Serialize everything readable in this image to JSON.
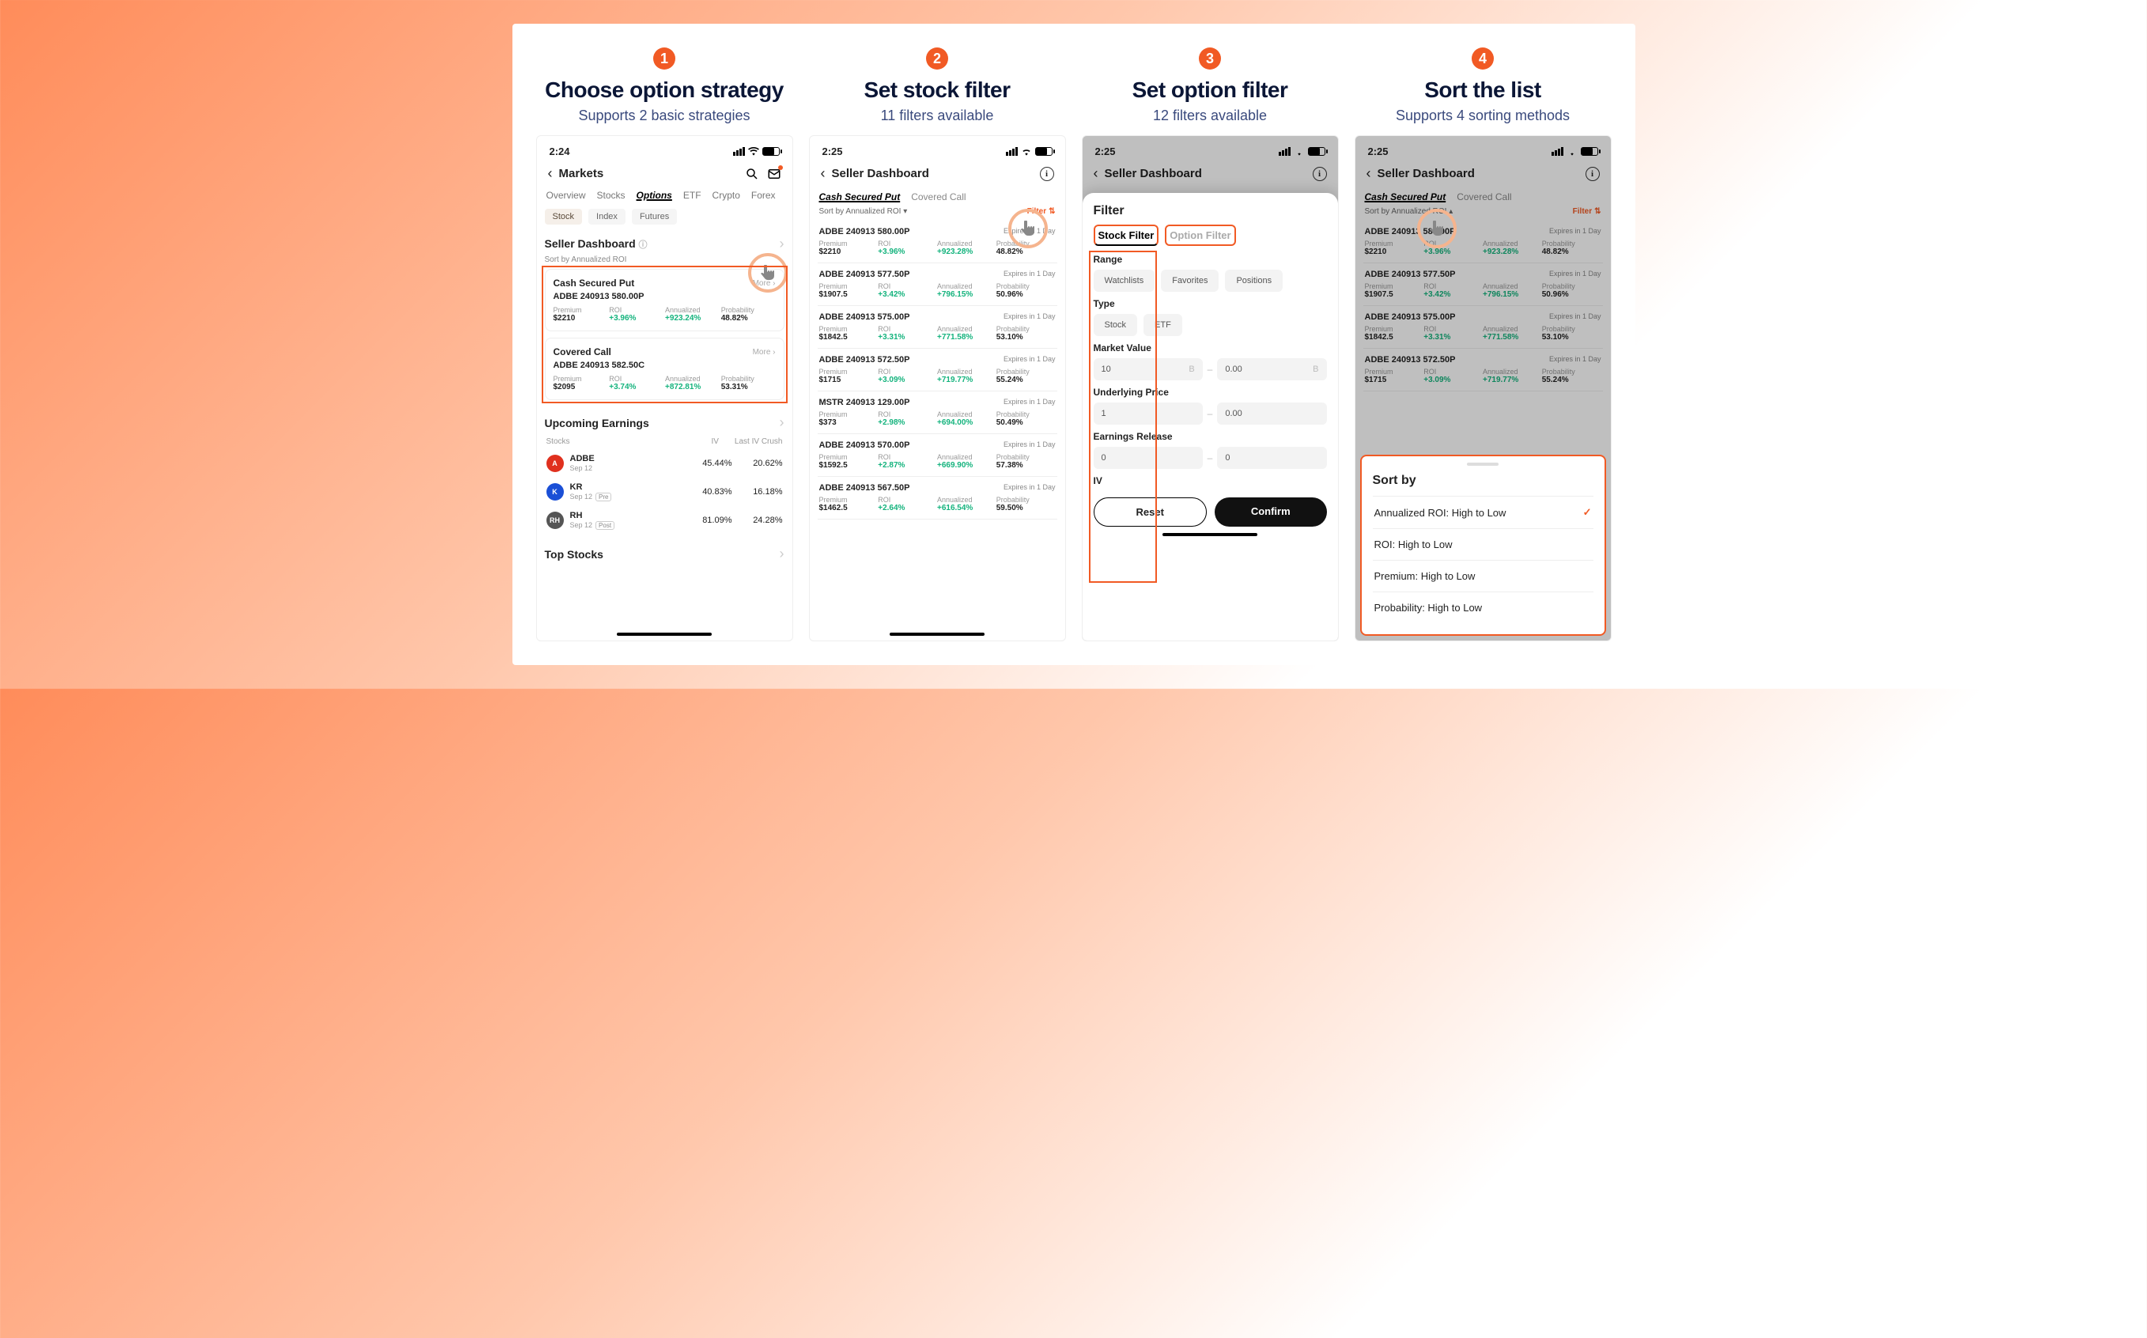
{
  "steps": [
    {
      "num": "1",
      "title": "Choose option strategy",
      "sub": "Supports 2 basic strategies"
    },
    {
      "num": "2",
      "title": "Set stock filter",
      "sub": "11 filters available"
    },
    {
      "num": "3",
      "title": "Set option filter",
      "sub": "12 filters available"
    },
    {
      "num": "4",
      "title": "Sort  the list",
      "sub": "Supports 4 sorting methods"
    }
  ],
  "p1": {
    "time": "2:24",
    "nav_title": "Markets",
    "tabs": [
      "Overview",
      "Stocks",
      "Options",
      "ETF",
      "Crypto",
      "Forex"
    ],
    "active_tab": "Options",
    "pill_row": [
      "Stock",
      "Index",
      "Futures"
    ],
    "dashboard": "Seller Dashboard",
    "sort_label": "Sort by Annualized ROI",
    "cards": [
      {
        "title": "Cash Secured Put",
        "more": "More",
        "contract": "ADBE 240913 580.00P",
        "premium_l": "Premium",
        "premium": "$2210",
        "roi_l": "ROI",
        "roi": "+3.96%",
        "ann_l": "Annualized",
        "ann": "+923.24%",
        "prob_l": "Probability",
        "prob": "48.82%"
      },
      {
        "title": "Covered Call",
        "more": "More",
        "contract": "ADBE 240913 582.50C",
        "premium_l": "Premium",
        "premium": "$2095",
        "roi_l": "ROI",
        "roi": "+3.74%",
        "ann_l": "Annualized",
        "ann": "+872.81%",
        "prob_l": "Probability",
        "prob": "53.31%"
      }
    ],
    "upcoming": "Upcoming Earnings",
    "earn_header": [
      "Stocks",
      "IV",
      "Last IV Crush"
    ],
    "earnings": [
      {
        "sym": "ADBE",
        "date": "Sep 12",
        "iv": "45.44%",
        "crush": "20.62%",
        "color": "#e0301e",
        "badge": ""
      },
      {
        "sym": "KR",
        "date": "Sep 12",
        "iv": "40.83%",
        "crush": "16.18%",
        "color": "#1a4fd6",
        "badge": "Pre"
      },
      {
        "sym": "RH",
        "date": "Sep 12",
        "iv": "81.09%",
        "crush": "24.28%",
        "color": "#555",
        "badge": "Post"
      }
    ],
    "top_stocks": "Top Stocks"
  },
  "p2": {
    "time": "2:25",
    "nav_title": "Seller Dashboard",
    "subtabs": [
      "Cash Secured Put",
      "Covered Call"
    ],
    "sort_label": "Sort by Annualized ROI ▾",
    "filter_label": "Filter",
    "col_labels": {
      "premium": "Premium",
      "roi": "ROI",
      "ann": "Annualized",
      "prob": "Probability"
    },
    "expires": "Expires in 1 Day",
    "rows": [
      {
        "c": "ADBE 240913 580.00P",
        "prem": "$2210",
        "roi": "+3.96%",
        "ann": "+923.28%",
        "prob": "48.82%"
      },
      {
        "c": "ADBE 240913 577.50P",
        "prem": "$1907.5",
        "roi": "+3.42%",
        "ann": "+796.15%",
        "prob": "50.96%"
      },
      {
        "c": "ADBE 240913 575.00P",
        "prem": "$1842.5",
        "roi": "+3.31%",
        "ann": "+771.58%",
        "prob": "53.10%"
      },
      {
        "c": "ADBE 240913 572.50P",
        "prem": "$1715",
        "roi": "+3.09%",
        "ann": "+719.77%",
        "prob": "55.24%"
      },
      {
        "c": "MSTR 240913 129.00P",
        "prem": "$373",
        "roi": "+2.98%",
        "ann": "+694.00%",
        "prob": "50.49%"
      },
      {
        "c": "ADBE 240913 570.00P",
        "prem": "$1592.5",
        "roi": "+2.87%",
        "ann": "+669.90%",
        "prob": "57.38%"
      },
      {
        "c": "ADBE 240913 567.50P",
        "prem": "$1462.5",
        "roi": "+2.64%",
        "ann": "+616.54%",
        "prob": "59.50%"
      }
    ]
  },
  "p3": {
    "time": "2:25",
    "nav_title": "Seller Dashboard",
    "sheet_title": "Filter",
    "filter_tabs": [
      "Stock Filter",
      "Option Filter"
    ],
    "range_label": "Range",
    "range_chips": [
      "Watchlists",
      "Favorites",
      "Positions"
    ],
    "type_label": "Type",
    "type_chips": [
      "Stock",
      "ETF"
    ],
    "mv_label": "Market Value",
    "mv_from": "10",
    "mv_from_unit": "B",
    "mv_to": "0.00",
    "mv_to_unit": "B",
    "up_label": "Underlying Price",
    "up_from": "1",
    "up_to": "0.00",
    "er_label": "Earnings Release",
    "er_from": "0",
    "er_to": "0",
    "iv_label": "IV",
    "reset": "Reset",
    "confirm": "Confirm"
  },
  "p4": {
    "time": "2:25",
    "nav_title": "Seller Dashboard",
    "subtabs": [
      "Cash Secured Put",
      "Covered Call"
    ],
    "sort_label": "Sort by Annualized ROI ▴",
    "filter_label": "Filter",
    "sort_sheet_title": "Sort by",
    "sort_options": [
      {
        "label": "Annualized ROI: High to Low",
        "selected": true
      },
      {
        "label": "ROI: High to Low",
        "selected": false
      },
      {
        "label": "Premium: High to Low",
        "selected": false
      },
      {
        "label": "Probability: High to Low",
        "selected": false
      }
    ]
  }
}
